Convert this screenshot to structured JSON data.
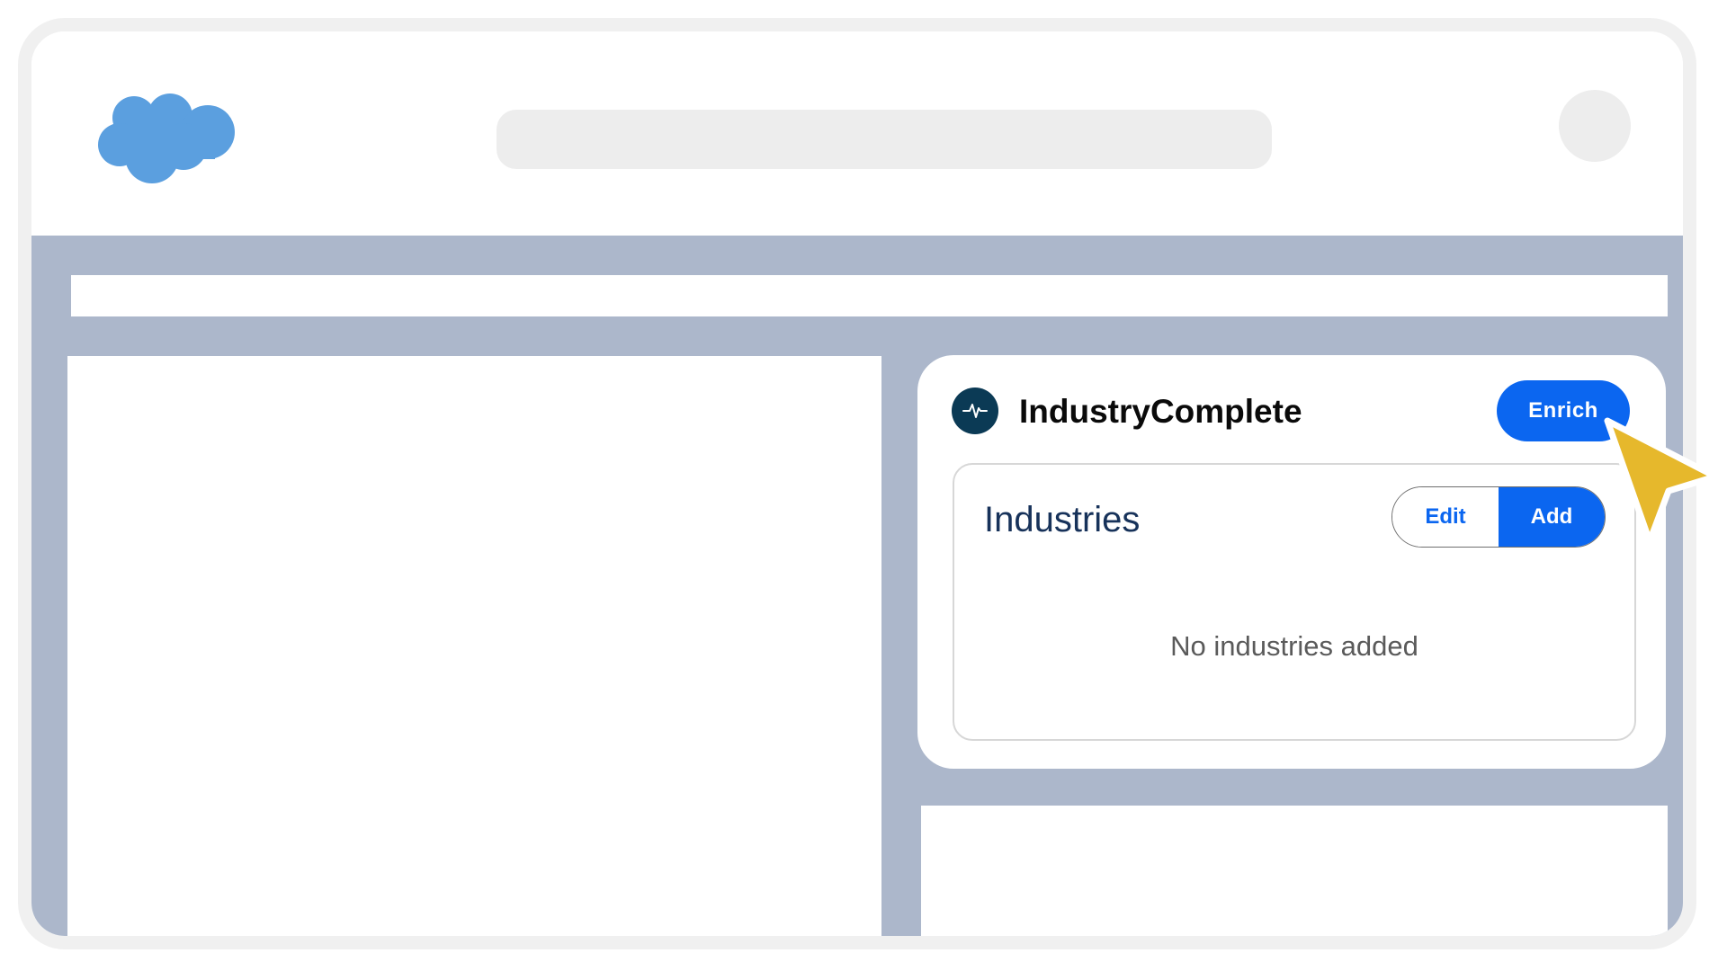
{
  "app": {
    "brand": "Salesforce",
    "logo_icon": "salesforce-cloud-icon"
  },
  "card": {
    "title": "IndustryComplete",
    "icon": "pulse-icon",
    "enrich_label": "Enrich",
    "section": {
      "title": "Industries",
      "edit_label": "Edit",
      "add_label": "Add",
      "empty_message": "No industries added"
    }
  },
  "colors": {
    "accent": "#0b66f0",
    "background": "#acb7cb",
    "logo": "#5b9fdf",
    "cursor": "#e6b82c",
    "icon_bg": "#0b3a55"
  }
}
